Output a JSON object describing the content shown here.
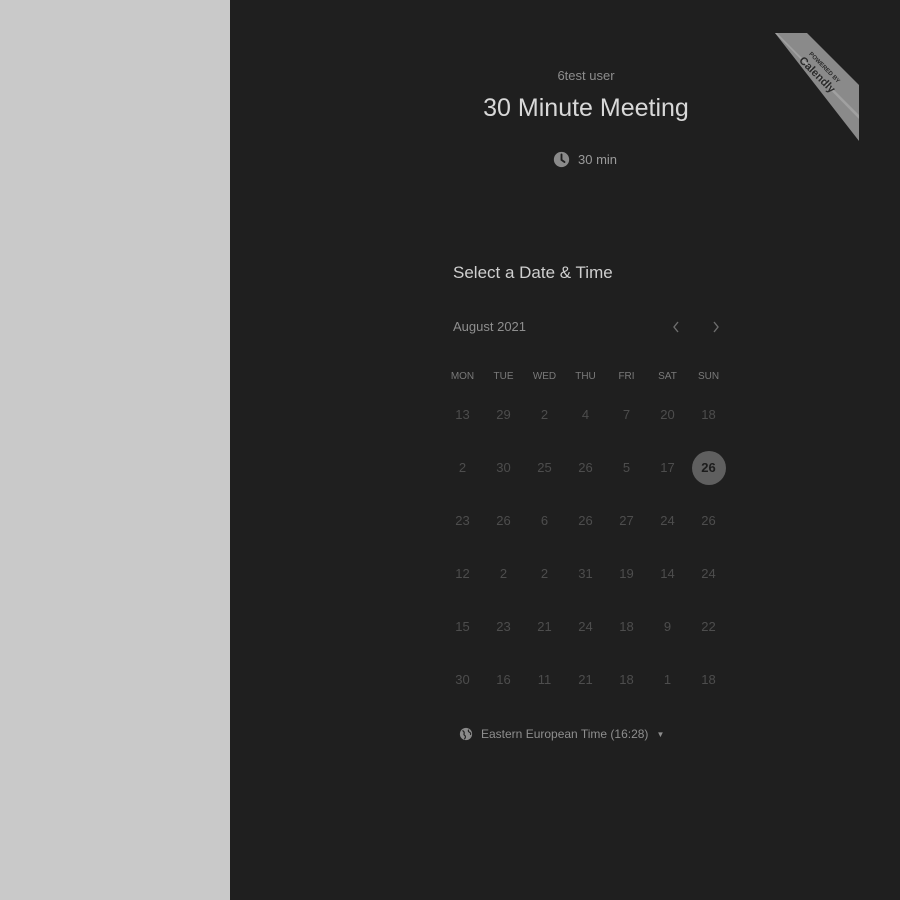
{
  "host": {
    "name": "6test user"
  },
  "event": {
    "title": "30 Minute Meeting",
    "duration": "30 min"
  },
  "badge": {
    "line1": "POWERED BY",
    "line2": "Calendly"
  },
  "calendar": {
    "heading": "Select a Date & Time",
    "month": "August 2021",
    "prev_icon": "chevron-left-icon",
    "next_icon": "chevron-right-icon",
    "weekdays": [
      "MON",
      "TUE",
      "WED",
      "THU",
      "FRI",
      "SAT",
      "SUN"
    ],
    "weeks": [
      [
        "13",
        "29",
        "2",
        "4",
        "7",
        "20",
        "18"
      ],
      [
        "2",
        "30",
        "25",
        "26",
        "5",
        "17",
        "26"
      ],
      [
        "23",
        "26",
        "6",
        "26",
        "27",
        "24",
        "26"
      ],
      [
        "12",
        "2",
        "2",
        "31",
        "19",
        "14",
        "24"
      ],
      [
        "15",
        "23",
        "21",
        "24",
        "18",
        "9",
        "22"
      ],
      [
        "30",
        "16",
        "11",
        "21",
        "18",
        "1",
        "18"
      ]
    ],
    "selected_week": 1,
    "selected_day": 6
  },
  "timezone": {
    "label": "Eastern European Time (16:28)",
    "icon": "globe-icon"
  },
  "colors": {
    "left_panel": "#c9c9c9",
    "main_panel": "#1f1f1f",
    "selected_day": "#5f5f5f"
  }
}
